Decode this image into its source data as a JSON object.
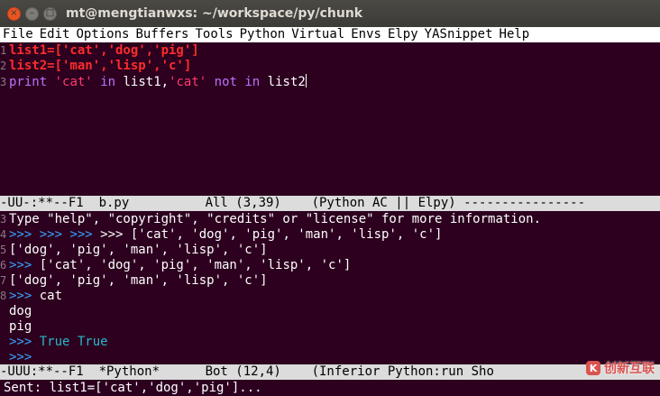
{
  "window": {
    "title": "mt@mengtianwxs: ~/workspace/py/chunk",
    "buttons": {
      "close": "×",
      "minimize": "–",
      "maximize": "□"
    }
  },
  "menubar": [
    "File",
    "Edit",
    "Options",
    "Buffers",
    "Tools",
    "Python",
    "Virtual",
    "Envs",
    "Elpy",
    "YASnippet",
    "Help"
  ],
  "editor": {
    "line1": {
      "num": "1",
      "text": "list1=['cat','dog','pig']"
    },
    "line2": {
      "num": "2",
      "text": "list2=['man','lisp','c']"
    },
    "line3": {
      "num": "3",
      "kw_print": "print",
      "str_cat1": "'cat'",
      "kw_in": "in",
      "ident1": "list1,",
      "str_cat2": "'cat'",
      "kw_not_in": "not in",
      "ident2": "list2"
    }
  },
  "modeline_editor": "-UU-:**--F1  b.py          All (3,39)    (Python AC || Elpy) ----------------",
  "shell": {
    "l1": {
      "num": "3",
      "text": "Type \"help\", \"copyright\", \"credits\" or \"license\" for more information."
    },
    "l2": {
      "num": "4",
      "prompt": ">>> >>> >>> ",
      "text": ">>> ['cat', 'dog', 'pig', 'man', 'lisp', 'c']"
    },
    "l3": {
      "num": "5",
      "text": "['dog', 'pig', 'man', 'lisp', 'c']"
    },
    "l4": {
      "num": "6",
      "prompt": ">>> ",
      "text": "['cat', 'dog', 'pig', 'man', 'lisp', 'c']"
    },
    "l5": {
      "num": "7",
      "text": "['dog', 'pig', 'man', 'lisp', 'c']"
    },
    "l6": {
      "num": "8",
      "prompt": ">>> ",
      "text": "cat"
    },
    "l7": {
      "text": "dog"
    },
    "l8": {
      "text": "pig"
    },
    "l9": {
      "prompt": ">>> ",
      "text": "True True"
    },
    "l10": {
      "prompt": ">>> "
    }
  },
  "modeline_shell": "-UUU:**--F1  *Python*      Bot (12,4)    (Inferior Python:run Sho",
  "minibuffer": "Sent: list1=['cat','dog','pig']...",
  "watermark": {
    "icon": "K",
    "text": "创新互联"
  },
  "colors": {
    "background": "#2c001e",
    "accent": "#e95420"
  }
}
